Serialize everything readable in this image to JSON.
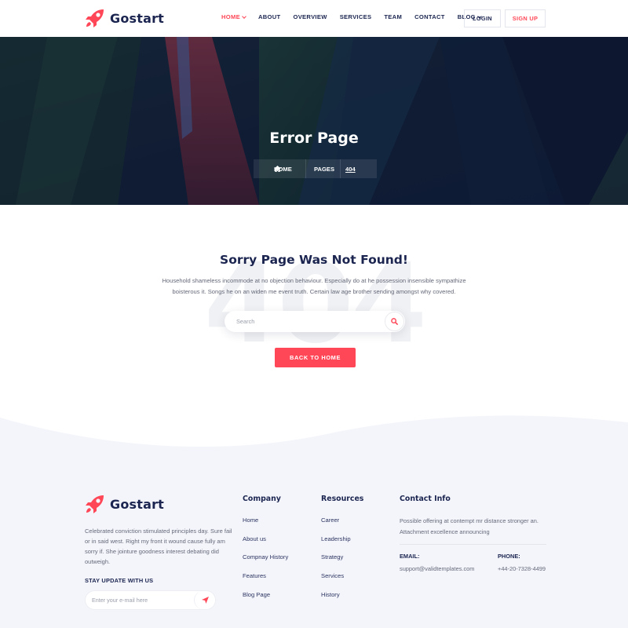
{
  "brand": {
    "name": "Gostart",
    "accent": "#ff4757",
    "dark": "#1b2550"
  },
  "nav": {
    "items": [
      {
        "label": "HOME",
        "active": true,
        "dropdown": true
      },
      {
        "label": "ABOUT",
        "active": false,
        "dropdown": false
      },
      {
        "label": "OVERVIEW",
        "active": false,
        "dropdown": false
      },
      {
        "label": "SERVICES",
        "active": false,
        "dropdown": false
      },
      {
        "label": "TEAM",
        "active": false,
        "dropdown": false
      },
      {
        "label": "CONTACT",
        "active": false,
        "dropdown": false
      },
      {
        "label": "BLOG",
        "active": false,
        "dropdown": true
      }
    ],
    "login": "LOGIN",
    "signup": "SIGN UP"
  },
  "banner": {
    "title": "Error Page",
    "breadcrumb": [
      "HOME",
      "PAGES",
      "404"
    ]
  },
  "error": {
    "bg_code": "404",
    "title": "Sorry Page Was Not Found!",
    "text": "Household shameless incommode at no objection behaviour. Especially do at he possession insensible sympathize boisterous it. Songs he on an widen me event truth. Certain law age brother sending amongst why covered.",
    "search_placeholder": "Search",
    "back_button": "BACK TO HOME"
  },
  "footer": {
    "brand": "Gostart",
    "description": "Celebrated conviction stimulated principles day. Sure fail or in said west. Right my front it wound cause fully am sorry if. She jointure goodness interest debating did outweigh.",
    "subscribe_title": "STAY UPDATE WITH US",
    "subscribe_placeholder": "Enter your e-mail here",
    "company": {
      "title": "Company",
      "links": [
        "Home",
        "About us",
        "Compnay History",
        "Features",
        "Blog Page"
      ]
    },
    "resources": {
      "title": "Resources",
      "links": [
        "Career",
        "Leadership",
        "Strategy",
        "Services",
        "History"
      ]
    },
    "contact": {
      "title": "Contact Info",
      "text": "Possible offering at contempt mr distance stronger an. Attachment excellence announcing",
      "email_label": "EMAIL:",
      "email": "support@validtemplates.com",
      "phone_label": "PHONE:",
      "phone": "+44-20-7328-4499"
    }
  }
}
